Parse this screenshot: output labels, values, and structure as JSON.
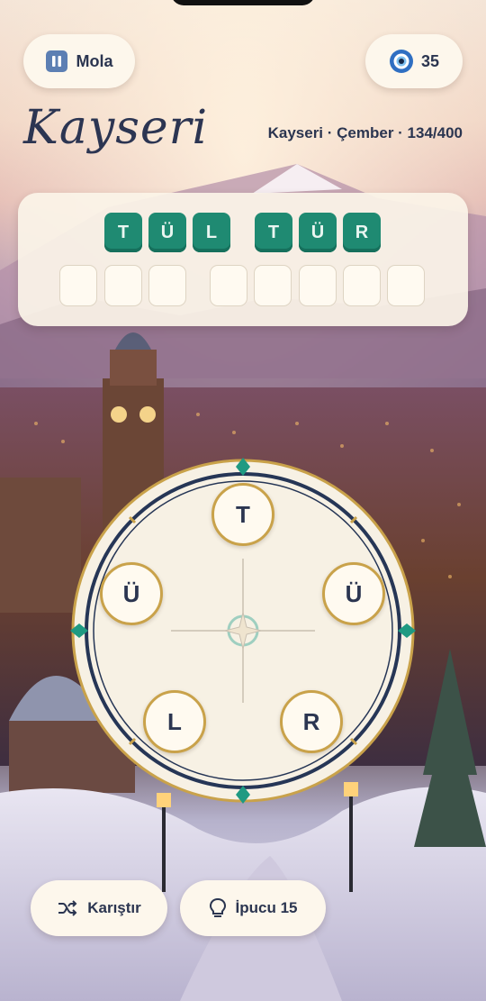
{
  "header": {
    "pause_label": "Mola",
    "coins": "35",
    "city_title": "Kayseri",
    "level_info": "Kayseri · Çember · 134/400"
  },
  "board": {
    "solved_words": [
      [
        "T",
        "Ü",
        "L"
      ],
      [
        "T",
        "Ü",
        "R"
      ]
    ],
    "empty_words": [
      3,
      5
    ]
  },
  "wheel": {
    "letters": [
      "T",
      "Ü",
      "R",
      "L",
      "Ü"
    ]
  },
  "actions": {
    "shuffle_label": "Karıştır",
    "hint_label": "İpucu 15"
  },
  "colors": {
    "tile": "#1f8a72",
    "navy": "#2b3550",
    "gold": "#c9a24a"
  }
}
